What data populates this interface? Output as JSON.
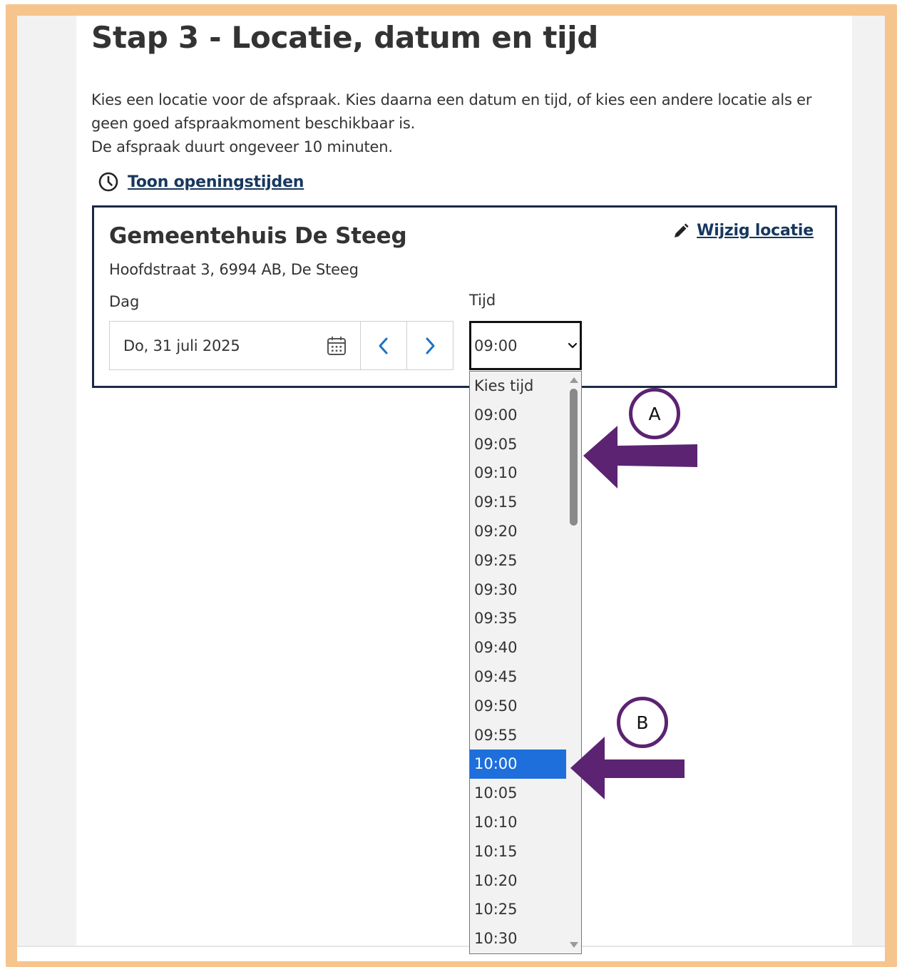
{
  "page": {
    "title": "Stap 3 - Locatie, datum en tijd",
    "intro_line_1": "Kies een locatie voor de afspraak. Kies daarna een datum en tijd, of kies een andere locatie als er geen goed afspraakmoment beschikbaar is.",
    "intro_line_2": "De afspraak duurt ongeveer 10 minuten.",
    "opening_hours_link": "Toon openingstijden",
    "opening_hours_icon": "clock-icon"
  },
  "location": {
    "name": "Gemeentehuis De Steeg",
    "address": "Hoofdstraat 3, 6994 AB, De Steeg",
    "change_link": "Wijzig locatie",
    "change_icon": "pencil-icon"
  },
  "date_field": {
    "label": "Dag",
    "value": "Do, 31 juli 2025",
    "calendar_icon": "calendar-icon",
    "prev_icon": "chevron-left-icon",
    "next_icon": "chevron-right-icon"
  },
  "time_field": {
    "label": "Tijd",
    "selected_value": "09:00",
    "options": [
      "Kies tijd",
      "09:00",
      "09:05",
      "09:10",
      "09:15",
      "09:20",
      "09:25",
      "09:30",
      "09:35",
      "09:40",
      "09:45",
      "09:50",
      "09:55",
      "10:00",
      "10:05",
      "10:10",
      "10:15",
      "10:20",
      "10:25",
      "10:30"
    ],
    "highlighted_option": "10:00"
  },
  "annotations": {
    "marker_a": "A",
    "marker_b": "B",
    "arrow_color": "#5b2372"
  },
  "colors": {
    "frame": "#f6c48d",
    "link": "#17375e",
    "card_border": "#1c2846",
    "highlight": "#1e6fdb",
    "nav_chevron": "#1a73c6"
  }
}
